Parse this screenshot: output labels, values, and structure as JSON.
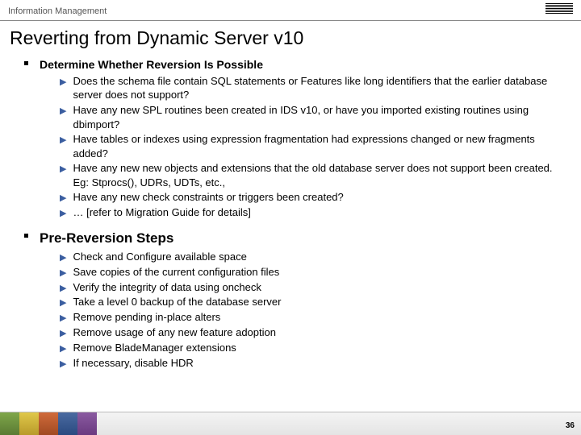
{
  "header": {
    "category": "Information Management",
    "logo_name": "ibm-logo"
  },
  "title": "Reverting from Dynamic Server v10",
  "sections": [
    {
      "heading": "Determine Whether Reversion Is Possible",
      "large": false,
      "items": [
        "Does the schema file contain SQL statements or Features like long identifiers that the earlier database server does not support?",
        "Have any new SPL routines been created in IDS v10, or have you imported existing routines using dbimport?",
        "Have tables or indexes using expression fragmentation had expressions changed or new fragments added?",
        "Have any new new objects and extensions that the old database server does not support been created.  Eg: Stprocs(), UDRs, UDTs, etc.,",
        "Have any new check constraints or triggers been created?",
        "… [refer to Migration Guide for details]"
      ]
    },
    {
      "heading": "Pre-Reversion Steps",
      "large": true,
      "items": [
        "Check and Configure available space",
        "Save copies of the current configuration files",
        "Verify the integrity of data using oncheck",
        "Take a level 0 backup of the database server",
        "Remove pending in-place alters",
        "Remove usage of any new feature adoption",
        "Remove BladeManager extensions",
        "If necessary, disable HDR"
      ]
    }
  ],
  "footer": {
    "page_number": "36"
  }
}
